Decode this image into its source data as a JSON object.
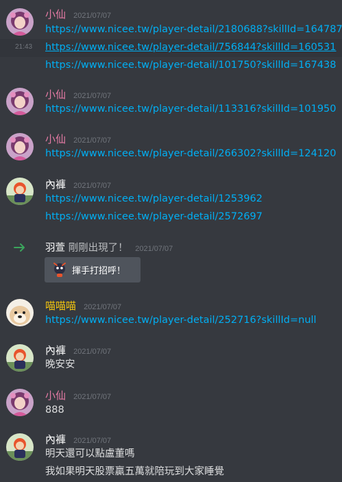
{
  "colors": {
    "background": "#36393f",
    "link": "#00aff4",
    "text": "#dcddde",
    "timestamp": "#72767d",
    "user_xiaoxian": "#e67ba5",
    "user_neiku": "#ffffff",
    "user_miaomiao": "#f1c40f",
    "join_green": "#3ba55c",
    "button_bg": "#4f545c"
  },
  "messages": [
    {
      "user": "小仙",
      "timestamp": "2021/07/07",
      "avatar": "girl-avatar",
      "lines": [
        "https://www.nicee.tw/player-detail/2180688?skillId=164787",
        "https://www.nicee.tw/player-detail/756844?skillId=160531",
        "https://www.nicee.tw/player-detail/101750?skillId=167438"
      ],
      "hover_time": "21:43"
    },
    {
      "user": "小仙",
      "timestamp": "2021/07/07",
      "avatar": "girl-avatar",
      "lines": [
        "https://www.nicee.tw/player-detail/113316?skillId=101950"
      ]
    },
    {
      "user": "小仙",
      "timestamp": "2021/07/07",
      "avatar": "girl-avatar",
      "lines": [
        "https://www.nicee.tw/player-detail/266302?skillId=124120"
      ]
    },
    {
      "user": "內褲",
      "timestamp": "2021/07/07",
      "avatar": "character-avatar",
      "lines": [
        "https://www.nicee.tw/player-detail/1253962",
        "https://www.nicee.tw/player-detail/2572697"
      ]
    },
    {
      "type": "join",
      "user": "羽萱",
      "text": "剛剛出現了！",
      "timestamp": "2021/07/07",
      "button_label": "揮手打招呼！",
      "icon": "wave-sticker-icon",
      "arrow_icon": "join-arrow-icon"
    },
    {
      "user": "喵喵喵",
      "timestamp": "2021/07/07",
      "avatar": "dog-avatar",
      "lines": [
        "https://www.nicee.tw/player-detail/252716?skillId=null"
      ]
    },
    {
      "user": "內褲",
      "timestamp": "2021/07/07",
      "avatar": "character-avatar",
      "lines": [
        "晚安安"
      ]
    },
    {
      "user": "小仙",
      "timestamp": "2021/07/07",
      "avatar": "girl-avatar",
      "lines": [
        "888"
      ]
    },
    {
      "user": "內褲",
      "timestamp": "2021/07/07",
      "avatar": "character-avatar",
      "lines": [
        "明天還可以點盧董嗎",
        "我如果明天股票贏五萬就陪玩到大家睡覺"
      ]
    }
  ]
}
